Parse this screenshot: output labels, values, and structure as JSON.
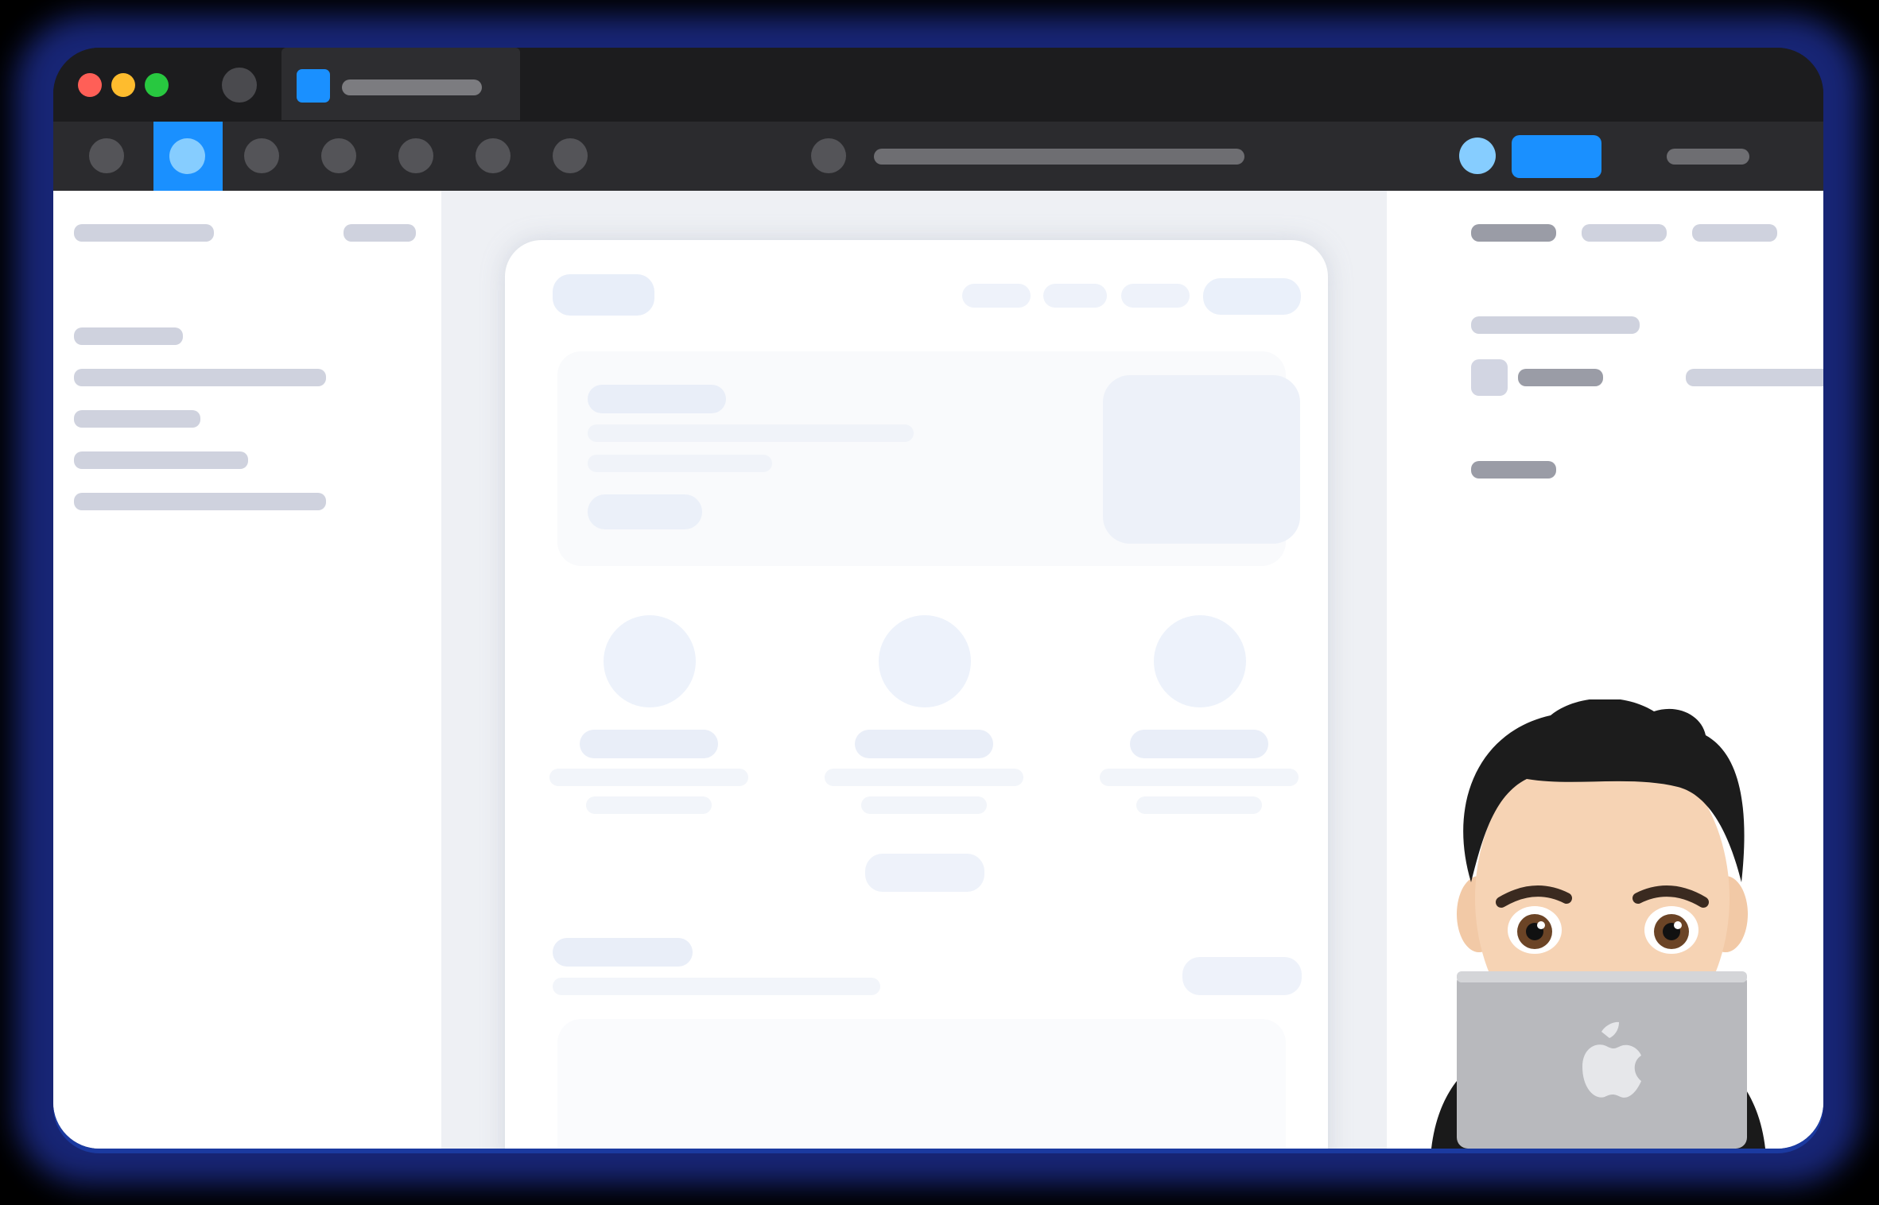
{
  "window": {
    "traffic_lights": {
      "close": "#ff5f57",
      "minimize": "#febc2e",
      "zoom": "#28c840"
    },
    "tab": {
      "favicon_color": "#1a90ff"
    }
  },
  "toolbar": {
    "tools": [
      {
        "icon": "tool-circle-icon",
        "active": false
      },
      {
        "icon": "tool-circle-icon",
        "active": true
      },
      {
        "icon": "tool-circle-icon",
        "active": false
      },
      {
        "icon": "tool-circle-icon",
        "active": false
      },
      {
        "icon": "tool-circle-icon",
        "active": false
      },
      {
        "icon": "tool-circle-icon",
        "active": false
      },
      {
        "icon": "tool-circle-icon",
        "active": false
      }
    ],
    "accent": "#1a90ff"
  },
  "colors": {
    "placeholder": "#cfd2de",
    "canvas": "#eef0f4",
    "panel": "#ffffff",
    "chrome": "#1c1c1e"
  },
  "overlay": {
    "avatar": "memoji-avatar",
    "laptop_logo": "apple-logo-icon"
  }
}
